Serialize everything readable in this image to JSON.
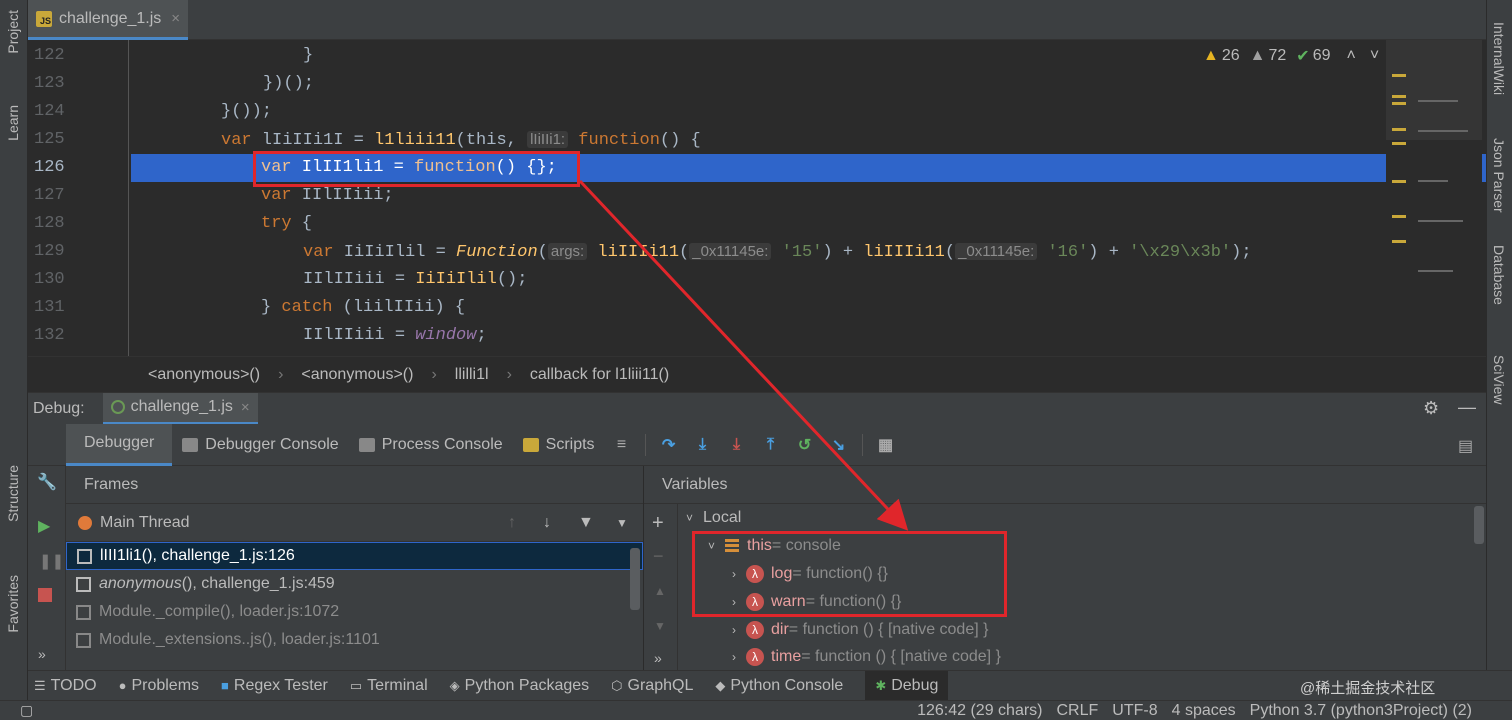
{
  "tab": {
    "file_name": "challenge_1.js",
    "badge": "JS",
    "close": "×"
  },
  "left_tools": {
    "project": "Project",
    "learn": "Learn",
    "structure": "Structure",
    "favorites": "Favorites"
  },
  "right_tools": {
    "internal_wiki": "InternalWiki",
    "json_parser": "Json Parser",
    "database": "Database",
    "sciview": "SciView"
  },
  "inspections": {
    "warnings": "26",
    "weak_warnings": "72",
    "typos": "69"
  },
  "code": {
    "line_numbers": [
      "122",
      "123",
      "124",
      "125",
      "126",
      "127",
      "128",
      "129",
      "130",
      "131",
      "132"
    ],
    "l122": "}",
    "l123": "})();",
    "l124": "}());",
    "l125": {
      "var": "var",
      "name": " lIiIIi1I = ",
      "call": "l1liii11",
      "open": "(this, ",
      "hint": "lIiIIi1:",
      "func": " function",
      "rest": "() {"
    },
    "l126": {
      "var": "var",
      "name": " IlII1li1 = ",
      "func": "function",
      "rest": "() {};"
    },
    "l127": {
      "var": "var",
      "rest": " IIlIIiii;"
    },
    "l128": {
      "try": "try",
      "rest": " {"
    },
    "l129": {
      "var": "var",
      "name": " IiIiIlil = ",
      "func_class": "Function",
      "open": "(",
      "hint1": "args:",
      "call1": " liIIIi11",
      "p1": "(",
      "hint2": "_0x11145e:",
      "s1": " '15'",
      "mid": ") + ",
      "call2": "liIIIi11",
      "p2": "(",
      "hint3": "_0x11145e:",
      "s2": " '16'",
      "mid2": ") + ",
      "s3": "'\\x29\\x3b'",
      "end": ");"
    },
    "l130": {
      "rest": "IIlIIiii = ",
      "call": "IiIiIlil",
      "end": "();"
    },
    "l131": {
      "close": "} ",
      "catch": "catch",
      "rest": " (liilIIii) {"
    },
    "l132": {
      "rest": "IIlIIiii = ",
      "window": "window",
      "end": ";"
    }
  },
  "breadcrumb": [
    "<anonymous>()",
    "<anonymous>()",
    "llilli1l",
    "callback for l1liii11()"
  ],
  "debug": {
    "label": "Debug:",
    "config": "challenge_1.js"
  },
  "debug_tabs": [
    "Debugger",
    "Debugger Console",
    "Process Console",
    "Scripts"
  ],
  "frames": {
    "header": "Frames",
    "thread": "Main Thread",
    "rows": [
      {
        "fn": "lIII1li1()",
        "loc": ", challenge_1.js:126"
      },
      {
        "fn": "anonymous",
        "fn2": "()",
        "loc": ", challenge_1.js:459"
      },
      {
        "fn": "Module._compile()",
        "loc": ", loader.js:1072"
      },
      {
        "fn": "Module._extensions..js()",
        "loc": ", loader.js:1101"
      }
    ]
  },
  "variables": {
    "header": "Variables",
    "local": "Local",
    "this_name": "this",
    "this_val": " = console",
    "items": [
      {
        "name": "log",
        "val": " = function() {}"
      },
      {
        "name": "warn",
        "val": " = function() {}"
      },
      {
        "name": "dir",
        "val": " = function () { [native code] }"
      },
      {
        "name": "time",
        "val": " = function () { [native code] }"
      }
    ]
  },
  "bottom_tools": [
    "TODO",
    "Problems",
    "Regex Tester",
    "Terminal",
    "Python Packages",
    "GraphQL",
    "Python Console",
    "Debug"
  ],
  "status": {
    "position": "126:42 (29 chars)",
    "line_sep": "CRLF",
    "encoding": "UTF-8",
    "indent": "4 spaces",
    "interpreter": "Python 3.7 (python3Project) (2)"
  },
  "watermark": "@稀土掘金技术社区",
  "colors": {
    "accent": "#4a88c7",
    "highlight": "#2f65ca",
    "annotation": "#e0262b"
  }
}
